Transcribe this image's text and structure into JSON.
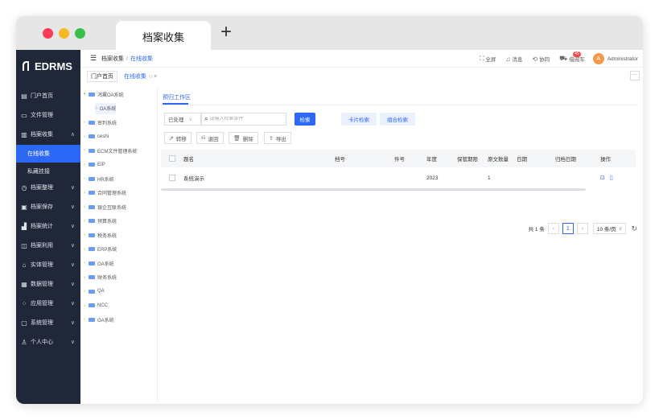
{
  "browser": {
    "tab_title": "档案收集",
    "new_tab_symbol": "+"
  },
  "sidebar": {
    "logo": "EDRMS",
    "items": [
      {
        "label": "门户首页",
        "icon": "home-icon",
        "glyph": "▤",
        "has_chevron": false
      },
      {
        "label": "文件管理",
        "icon": "file-icon",
        "glyph": "▭",
        "has_chevron": false
      },
      {
        "label": "档案收集",
        "icon": "collect-icon",
        "glyph": "▥",
        "has_chevron": true,
        "chevron": "∧"
      },
      {
        "label": "档案整理",
        "icon": "organize-icon",
        "glyph": "◷",
        "has_chevron": true,
        "chevron": "∨"
      },
      {
        "label": "档案保存",
        "icon": "storage-icon",
        "glyph": "▣",
        "has_chevron": true,
        "chevron": "∨"
      },
      {
        "label": "档案统计",
        "icon": "statistics-icon",
        "glyph": "▟",
        "has_chevron": true,
        "chevron": "∨"
      },
      {
        "label": "档案利用",
        "icon": "use-icon",
        "glyph": "◫",
        "has_chevron": true,
        "chevron": "∨"
      },
      {
        "label": "实体管理",
        "icon": "entity-icon",
        "glyph": "⌂",
        "has_chevron": true,
        "chevron": "∨"
      },
      {
        "label": "数据管理",
        "icon": "data-icon",
        "glyph": "▦",
        "has_chevron": true,
        "chevron": "∨"
      },
      {
        "label": "应用管理",
        "icon": "app-icon",
        "glyph": "⁘",
        "has_chevron": true,
        "chevron": "∨"
      },
      {
        "label": "系统管理",
        "icon": "system-icon",
        "glyph": "▢",
        "has_chevron": true,
        "chevron": "∨"
      },
      {
        "label": "个人中心",
        "icon": "user-icon",
        "glyph": "♙",
        "has_chevron": true,
        "chevron": "∨"
      }
    ],
    "sub_items": [
      {
        "label": "在线收集",
        "active": true
      },
      {
        "label": "私藏挂接",
        "active": false
      }
    ]
  },
  "header": {
    "breadcrumb": [
      "档案收集",
      "在线收集"
    ],
    "breadcrumb_sep": "/",
    "tools": [
      {
        "label": "全屏",
        "icon": "fullscreen-icon",
        "glyph": "⛶"
      },
      {
        "label": "消息",
        "icon": "bell-icon",
        "glyph": "♫"
      },
      {
        "label": "协同",
        "icon": "cooperate-icon",
        "glyph": "⟲"
      },
      {
        "label": "借阅车",
        "icon": "cart-icon",
        "glyph": "⛟",
        "badge": "45"
      }
    ],
    "avatar_letter": "A",
    "username": "Administrator"
  },
  "page_tabs": {
    "home": "门户首页",
    "current": "在线收集",
    "current_icons": "○ ×",
    "more": "···"
  },
  "tree": {
    "nodes": [
      {
        "label": "鸿翼OA系统",
        "expanded": true,
        "arrow": "▾"
      },
      {
        "label": "OA系统",
        "child": true,
        "selected": true
      },
      {
        "label": "审判系统",
        "arrow": "›"
      },
      {
        "label": "ceshi",
        "arrow": "›"
      },
      {
        "label": "ECM文件管理系统",
        "arrow": "›"
      },
      {
        "label": "EIP",
        "arrow": "›"
      },
      {
        "label": "HR系统",
        "arrow": "›"
      },
      {
        "label": "合同管理系统",
        "arrow": "›"
      },
      {
        "label": "银企互联系统",
        "arrow": "›"
      },
      {
        "label": "预算系统",
        "arrow": "›"
      },
      {
        "label": "税务系统",
        "arrow": "›"
      },
      {
        "label": "ERP系统",
        "arrow": "›"
      },
      {
        "label": "OA系统",
        "arrow": "›"
      },
      {
        "label": "财务系统",
        "arrow": "›"
      },
      {
        "label": "QA",
        "arrow": "›"
      },
      {
        "label": "NCC",
        "arrow": "›"
      },
      {
        "label": "OA系统",
        "arrow": "›"
      }
    ]
  },
  "main": {
    "section_title": "预归工作区",
    "filter": {
      "value": "已处理",
      "caret": "∨"
    },
    "search": {
      "placeholder": "请输入检索条件"
    },
    "buttons": {
      "search": "检索",
      "card_search": "卡片检索",
      "combo_search": "组合检索"
    },
    "actions": [
      {
        "label": "转移",
        "icon": "move-icon",
        "glyph": "⇗"
      },
      {
        "label": "退回",
        "icon": "return-icon",
        "glyph": "⎌"
      },
      {
        "label": "删除",
        "icon": "trash-icon",
        "glyph": "🗑"
      },
      {
        "label": "导出",
        "icon": "export-icon",
        "glyph": "⇪"
      }
    ],
    "table": {
      "columns": [
        "题名",
        "档号",
        "件号",
        "年度",
        "保管期限",
        "原文数量",
        "日期",
        "归档日期",
        "操作"
      ],
      "rows": [
        {
          "title": "系统演示",
          "archive_no": "",
          "item_no": "",
          "year": "2023",
          "retention": "",
          "count": "1",
          "date": "",
          "archive_date": ""
        }
      ]
    },
    "pagination": {
      "total": "共 1 条",
      "prev": "‹",
      "page": "1",
      "next": "›",
      "page_size": "10 条/页",
      "page_size_caret": "∨",
      "refresh": "↻"
    }
  }
}
